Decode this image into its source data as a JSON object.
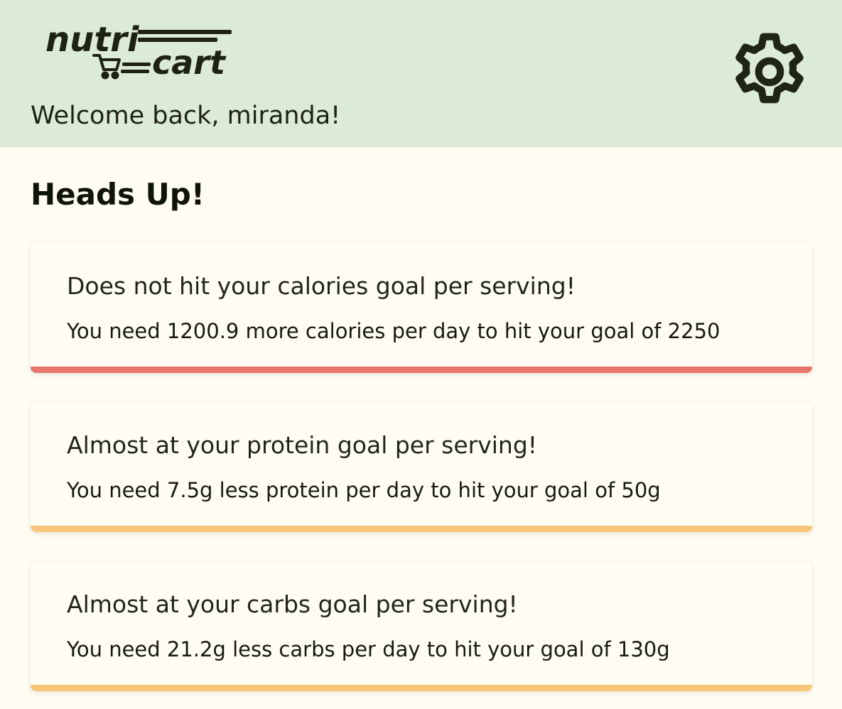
{
  "header": {
    "logo": {
      "text_top": "nutri",
      "text_bottom": "cart",
      "icon": "shopping-cart-icon"
    },
    "welcome": "Welcome back, miranda!",
    "settings_icon": "gear-icon"
  },
  "section": {
    "title": "Heads Up!"
  },
  "alerts": [
    {
      "title": "Does not hit your calories goal per serving!",
      "message": "You need 1200.9 more calories per day to hit your goal of 2250",
      "status": "danger",
      "color": "#e7756c"
    },
    {
      "title": "Almost at your protein goal per serving!",
      "message": "You need 7.5g less protein per day to hit your goal of 50g",
      "status": "warning",
      "color": "#f7c679"
    },
    {
      "title": "Almost at your carbs goal per serving!",
      "message": "You need 21.2g less carbs per day to hit your goal of 130g",
      "status": "warning",
      "color": "#f7c679"
    }
  ],
  "colors": {
    "header_bg": "#dcebd5",
    "page_bg": "#fffcf2",
    "text": "#1f2515",
    "danger": "#e7756c",
    "warning": "#f7c679"
  }
}
